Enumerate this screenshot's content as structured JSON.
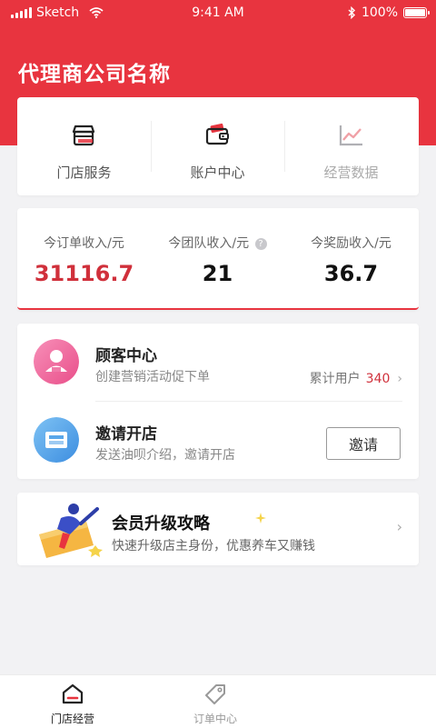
{
  "status_bar": {
    "carrier": "Sketch",
    "time": "9:41 AM",
    "battery": "100%",
    "battery_level": 1.0,
    "icons": [
      "signal-icon",
      "wifi-icon",
      "bluetooth-icon",
      "battery-icon"
    ]
  },
  "header": {
    "title": "代理商公司名称",
    "background_color": "#e8343f"
  },
  "quick_actions": [
    {
      "label": "门店服务",
      "icon": "storefront-icon",
      "enabled": true
    },
    {
      "label": "账户中心",
      "icon": "wallet-icon",
      "enabled": true
    },
    {
      "label": "经营数据",
      "icon": "line-chart-icon",
      "enabled": false
    }
  ],
  "income": [
    {
      "label": "今订单收入/元",
      "value": "31116.7",
      "color": "#d0303b"
    },
    {
      "label": "今团队收入/元",
      "value": "21",
      "help_icon": "?",
      "color": "#111111"
    },
    {
      "label": "今奖励收入/元",
      "value": "36.7",
      "color": "#111111"
    }
  ],
  "services": {
    "customer": {
      "title": "顾客中心",
      "subtitle": "创建营销活动促下单",
      "stat_label": "累计用户",
      "stat_value": "340",
      "icon": "customer-center-icon"
    },
    "invite": {
      "title": "邀请开店",
      "subtitle": "发送油呗介绍，邀请开店",
      "button": "邀请",
      "icon": "invite-store-icon"
    }
  },
  "promo": {
    "title": "会员升级攻略",
    "subtitle": "快速升级店主身份，优惠养车又赚钱",
    "icon": "member-upgrade-illustration"
  },
  "tabbar": [
    {
      "label": "门店经营",
      "icon": "store-tab-icon",
      "active": true
    },
    {
      "label": "订单中心",
      "icon": "tag-tab-icon",
      "active": false
    }
  ],
  "colors": {
    "accent": "#e8343f",
    "value_red": "#d0303b",
    "page_bg": "#f2f2f4"
  }
}
